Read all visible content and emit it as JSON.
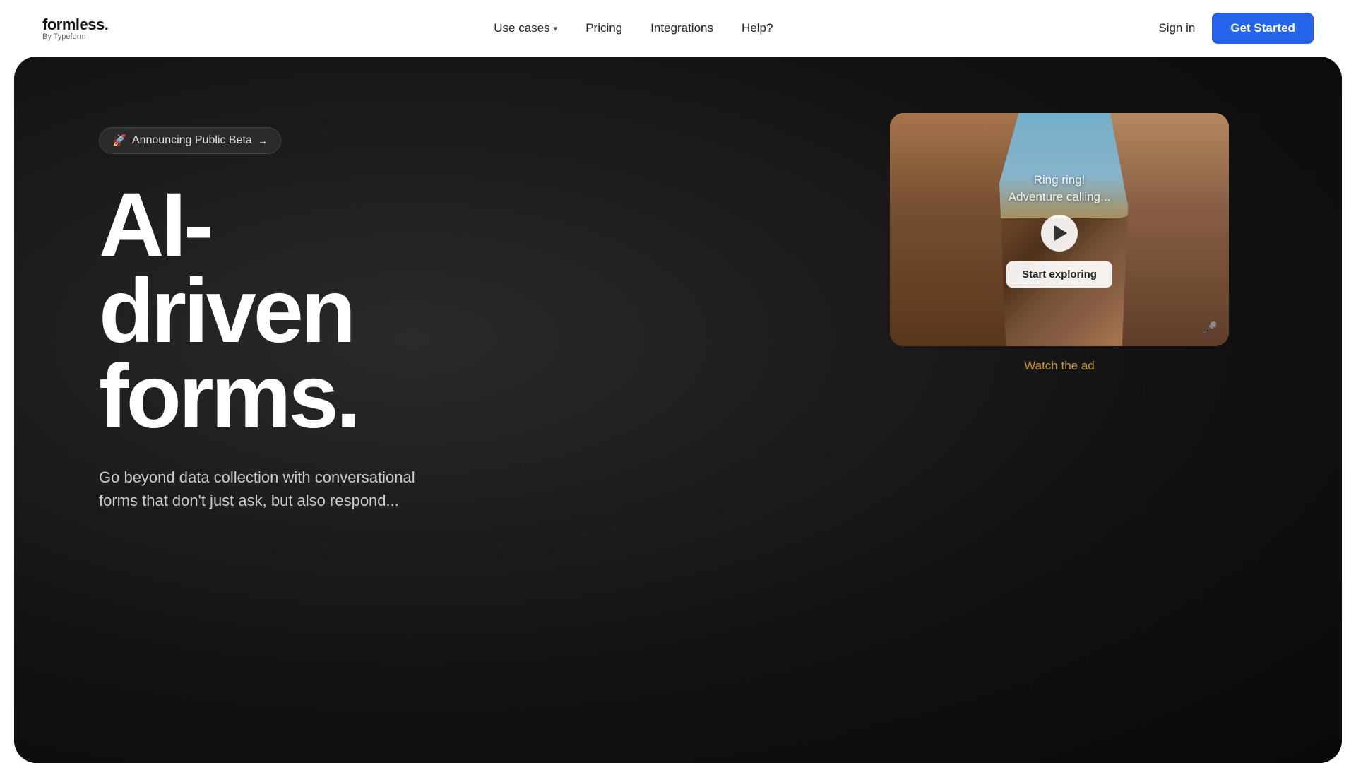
{
  "nav": {
    "logo": {
      "main": "formless.",
      "sub": "By Typeform"
    },
    "links": [
      {
        "label": "Use cases",
        "hasDropdown": true
      },
      {
        "label": "Pricing",
        "hasDropdown": false
      },
      {
        "label": "Integrations",
        "hasDropdown": false
      },
      {
        "label": "Help?",
        "hasDropdown": false
      }
    ],
    "sign_in": "Sign in",
    "get_started": "Get Started"
  },
  "hero": {
    "beta_badge": {
      "emoji": "🚀",
      "text": "Announcing Public Beta",
      "arrow": "→"
    },
    "title_line1": "AI-driven",
    "title_line2": "forms.",
    "subtitle": "Go beyond data collection with conversational forms that don't just ask, but also respond...",
    "video": {
      "call_text_line1": "Ring ring!",
      "call_text_line2": "Adventure calling...",
      "start_exploring": "Start exploring",
      "watch_the_ad": "Watch the ad"
    }
  },
  "colors": {
    "accent_blue": "#2563EB",
    "accent_yellow": "#c8932a",
    "dark_bg": "#1a1a1a"
  }
}
